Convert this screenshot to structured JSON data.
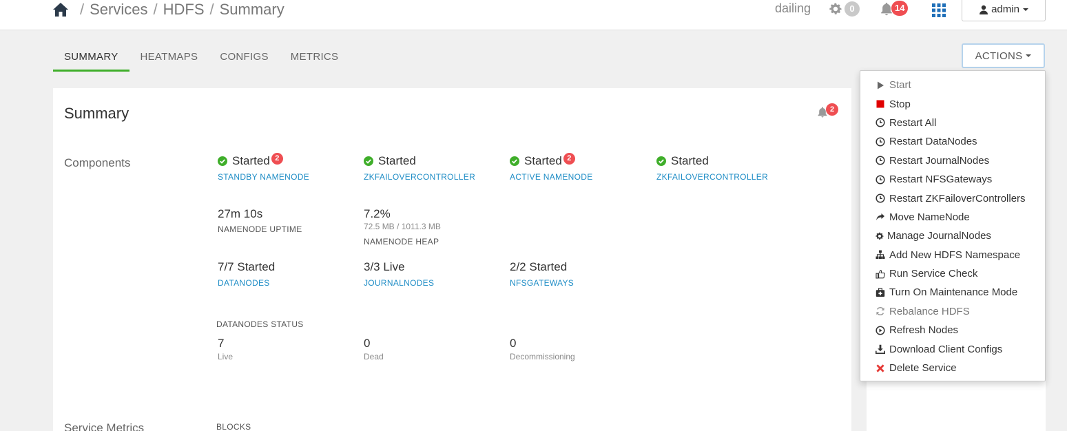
{
  "breadcrumb": {
    "items": [
      "Services",
      "HDFS",
      "Summary"
    ],
    "separator": "/"
  },
  "header": {
    "cluster_name": "dailing",
    "ops_count": "0",
    "alerts_count": "14",
    "user_label": "admin"
  },
  "tabs": [
    {
      "label": "SUMMARY",
      "active": true
    },
    {
      "label": "HEATMAPS",
      "active": false
    },
    {
      "label": "CONFIGS",
      "active": false
    },
    {
      "label": "METRICS",
      "active": false
    }
  ],
  "actions_label": "ACTIONS",
  "summary": {
    "title": "Summary",
    "alerts_badge": "2",
    "components_label": "Components",
    "components": [
      {
        "status": "Started",
        "badge": "2",
        "name": "STANDBY NAMENODE"
      },
      {
        "status": "Started",
        "badge": "",
        "name": "ZKFAILOVERCONTROLLER"
      },
      {
        "status": "Started",
        "badge": "2",
        "name": "ACTIVE NAMENODE"
      },
      {
        "status": "Started",
        "badge": "",
        "name": "ZKFAILOVERCONTROLLER"
      }
    ],
    "uptime": {
      "value": "27m 10s",
      "label": "NAMENODE UPTIME"
    },
    "heap": {
      "value": "7.2%",
      "detail": "72.5 MB / 1011.3 MB",
      "label": "NAMENODE HEAP"
    },
    "datanodes": {
      "value": "7/7 Started",
      "link": "DATANODES"
    },
    "journalnodes": {
      "value": "3/3 Live",
      "link": "JOURNALNODES"
    },
    "nfsgateways": {
      "value": "2/2 Started",
      "link": "NFSGATEWAYS"
    },
    "datanodes_status": {
      "heading": "DATANODES STATUS",
      "live": {
        "value": "7",
        "label": "Live"
      },
      "dead": {
        "value": "0",
        "label": "Dead"
      },
      "decommissioning": {
        "value": "0",
        "label": "Decommissioning"
      }
    },
    "service_metrics_label": "Service Metrics",
    "blocks_label": "BLOCKS"
  },
  "menu": [
    {
      "label": "Start",
      "icon": "play-icon",
      "disabled": true
    },
    {
      "label": "Stop",
      "icon": "stop-icon"
    },
    {
      "label": "Restart All",
      "icon": "clock-icon"
    },
    {
      "label": "Restart DataNodes",
      "icon": "clock-icon"
    },
    {
      "label": "Restart JournalNodes",
      "icon": "clock-icon"
    },
    {
      "label": "Restart NFSGateways",
      "icon": "clock-icon"
    },
    {
      "label": "Restart ZKFailoverControllers",
      "icon": "clock-icon"
    },
    {
      "label": "Move NameNode",
      "icon": "share-arrow-icon"
    },
    {
      "label": "Manage JournalNodes",
      "icon": "cog-icon"
    },
    {
      "label": "Add New HDFS Namespace",
      "icon": "sitemap-icon"
    },
    {
      "label": "Run Service Check",
      "icon": "thumbs-up-icon"
    },
    {
      "label": "Turn On Maintenance Mode",
      "icon": "medkit-icon"
    },
    {
      "label": "Rebalance HDFS",
      "icon": "refresh-icon"
    },
    {
      "label": "Refresh Nodes",
      "icon": "play-circle-icon"
    },
    {
      "label": "Download Client Configs",
      "icon": "download-icon"
    },
    {
      "label": "Delete Service",
      "icon": "remove-icon"
    }
  ],
  "colors": {
    "accent_green": "#3fae2a",
    "link_blue": "#1f8dc6",
    "badge_red": "#ef4e52",
    "stop_red": "#e00000"
  }
}
